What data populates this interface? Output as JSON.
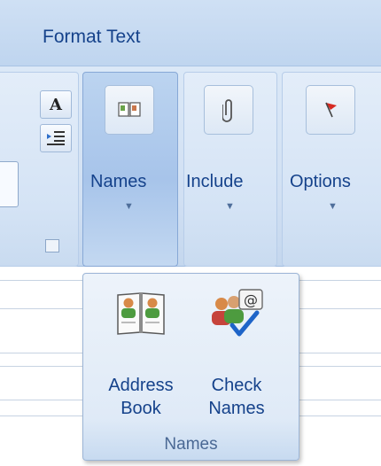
{
  "tabbar": {
    "active_tab": "Format Text"
  },
  "ribbon": {
    "basic_text": {
      "small_buttons": [
        "A",
        "≡"
      ]
    },
    "names_button": {
      "label": "Names",
      "icon": "book-icon"
    },
    "include_button": {
      "label": "Include",
      "icon": "paperclip-icon"
    },
    "options_button": {
      "label": "Options",
      "icon": "flag-icon"
    }
  },
  "names_popup": {
    "address_book": {
      "line1": "Address",
      "line2": "Book",
      "icon": "address-book-icon"
    },
    "check_names": {
      "line1": "Check",
      "line2": "Names",
      "icon": "check-names-icon"
    },
    "group_label": "Names"
  },
  "colors": {
    "ribbon_text": "#15428b",
    "ribbon_bg": "#d1e0f3",
    "accent": "#1e64c8"
  }
}
